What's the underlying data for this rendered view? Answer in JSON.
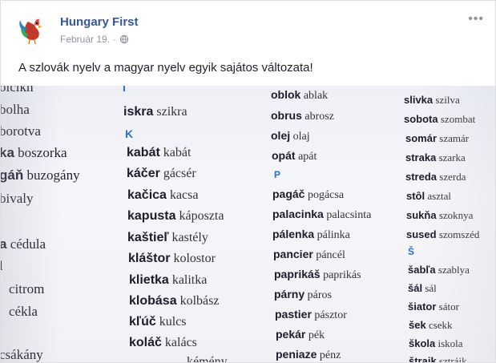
{
  "post": {
    "page_name": "Hungary First",
    "date": "Február 19.",
    "privacy_icon": "globe-icon",
    "more_icon": "ellipsis-icon",
    "text": "A szlovák nyelv a magyar nyelv egyik sajátos változata!"
  },
  "colors": {
    "link": "#365899",
    "meta": "#90949c",
    "letter": "#2b6fd6"
  },
  "photo": {
    "col1": [
      {
        "sk": "bolha",
        "hu": ""
      },
      {
        "sk": "borotva",
        "hu": ""
      },
      {
        "sk": "ka",
        "hu": "boszorka"
      },
      {
        "sk": "gáň",
        "hu": "buzogány"
      },
      {
        "sk": "bivaly",
        "hu": ""
      },
      {
        "sk": "a",
        "hu": "cédula"
      },
      {
        "sk": "l",
        "hu": ""
      },
      {
        "sk": "citrom",
        "hu": ""
      },
      {
        "sk": "cékla",
        "hu": ""
      },
      {
        "sk": "csákány",
        "hu": ""
      }
    ],
    "col2": [
      {
        "sk": "iskra",
        "hu": "szikra"
      },
      {
        "letter": "K"
      },
      {
        "sk": "kabát",
        "hu": "kabát"
      },
      {
        "sk": "káčer",
        "hu": "gácsér"
      },
      {
        "sk": "kačica",
        "hu": "kacsa"
      },
      {
        "sk": "kapusta",
        "hu": "káposzta"
      },
      {
        "sk": "kaštieľ",
        "hu": "kastély"
      },
      {
        "sk": "kláštor",
        "hu": "kolostor"
      },
      {
        "sk": "klietka",
        "hu": "kalitka"
      },
      {
        "sk": "klobása",
        "hu": "kolbász"
      },
      {
        "sk": "kľúč",
        "hu": "kulcs"
      },
      {
        "sk": "koláč",
        "hu": "kalács"
      },
      {
        "sk": "",
        "hu": "kémény"
      }
    ],
    "col3": [
      {
        "sk": "oblok",
        "hu": "ablak"
      },
      {
        "sk": "obrus",
        "hu": "abrosz"
      },
      {
        "sk": "olej",
        "hu": "olaj"
      },
      {
        "sk": "opát",
        "hu": "apát"
      },
      {
        "letter": "P"
      },
      {
        "sk": "pagáč",
        "hu": "pogácsa"
      },
      {
        "sk": "palacinka",
        "hu": "palacsinta"
      },
      {
        "sk": "pálenka",
        "hu": "pálinka"
      },
      {
        "sk": "pancier",
        "hu": "páncél"
      },
      {
        "sk": "paprikáš",
        "hu": "paprikás"
      },
      {
        "sk": "párny",
        "hu": "páros"
      },
      {
        "sk": "pastier",
        "hu": "pásztor"
      },
      {
        "sk": "pekár",
        "hu": "pék"
      },
      {
        "sk": "peniaze",
        "hu": "pénz"
      }
    ],
    "col4": [
      {
        "sk": "slivka",
        "hu": "szilva"
      },
      {
        "sk": "sobota",
        "hu": "szombat"
      },
      {
        "sk": "somár",
        "hu": "szamár"
      },
      {
        "sk": "straka",
        "hu": "szarka"
      },
      {
        "sk": "streda",
        "hu": "szerda"
      },
      {
        "sk": "stôl",
        "hu": "asztal"
      },
      {
        "sk": "sukňa",
        "hu": "szoknya"
      },
      {
        "sk": "sused",
        "hu": "szomszéd"
      },
      {
        "letter": "Š"
      },
      {
        "sk": "šabľa",
        "hu": "szablya"
      },
      {
        "sk": "šál",
        "hu": "sál"
      },
      {
        "sk": "šiator",
        "hu": "sátor"
      },
      {
        "sk": "šek",
        "hu": "csekk"
      },
      {
        "sk": "škola",
        "hu": "iskola"
      },
      {
        "sk": "štrajk",
        "hu": "sztrájk"
      }
    ]
  }
}
